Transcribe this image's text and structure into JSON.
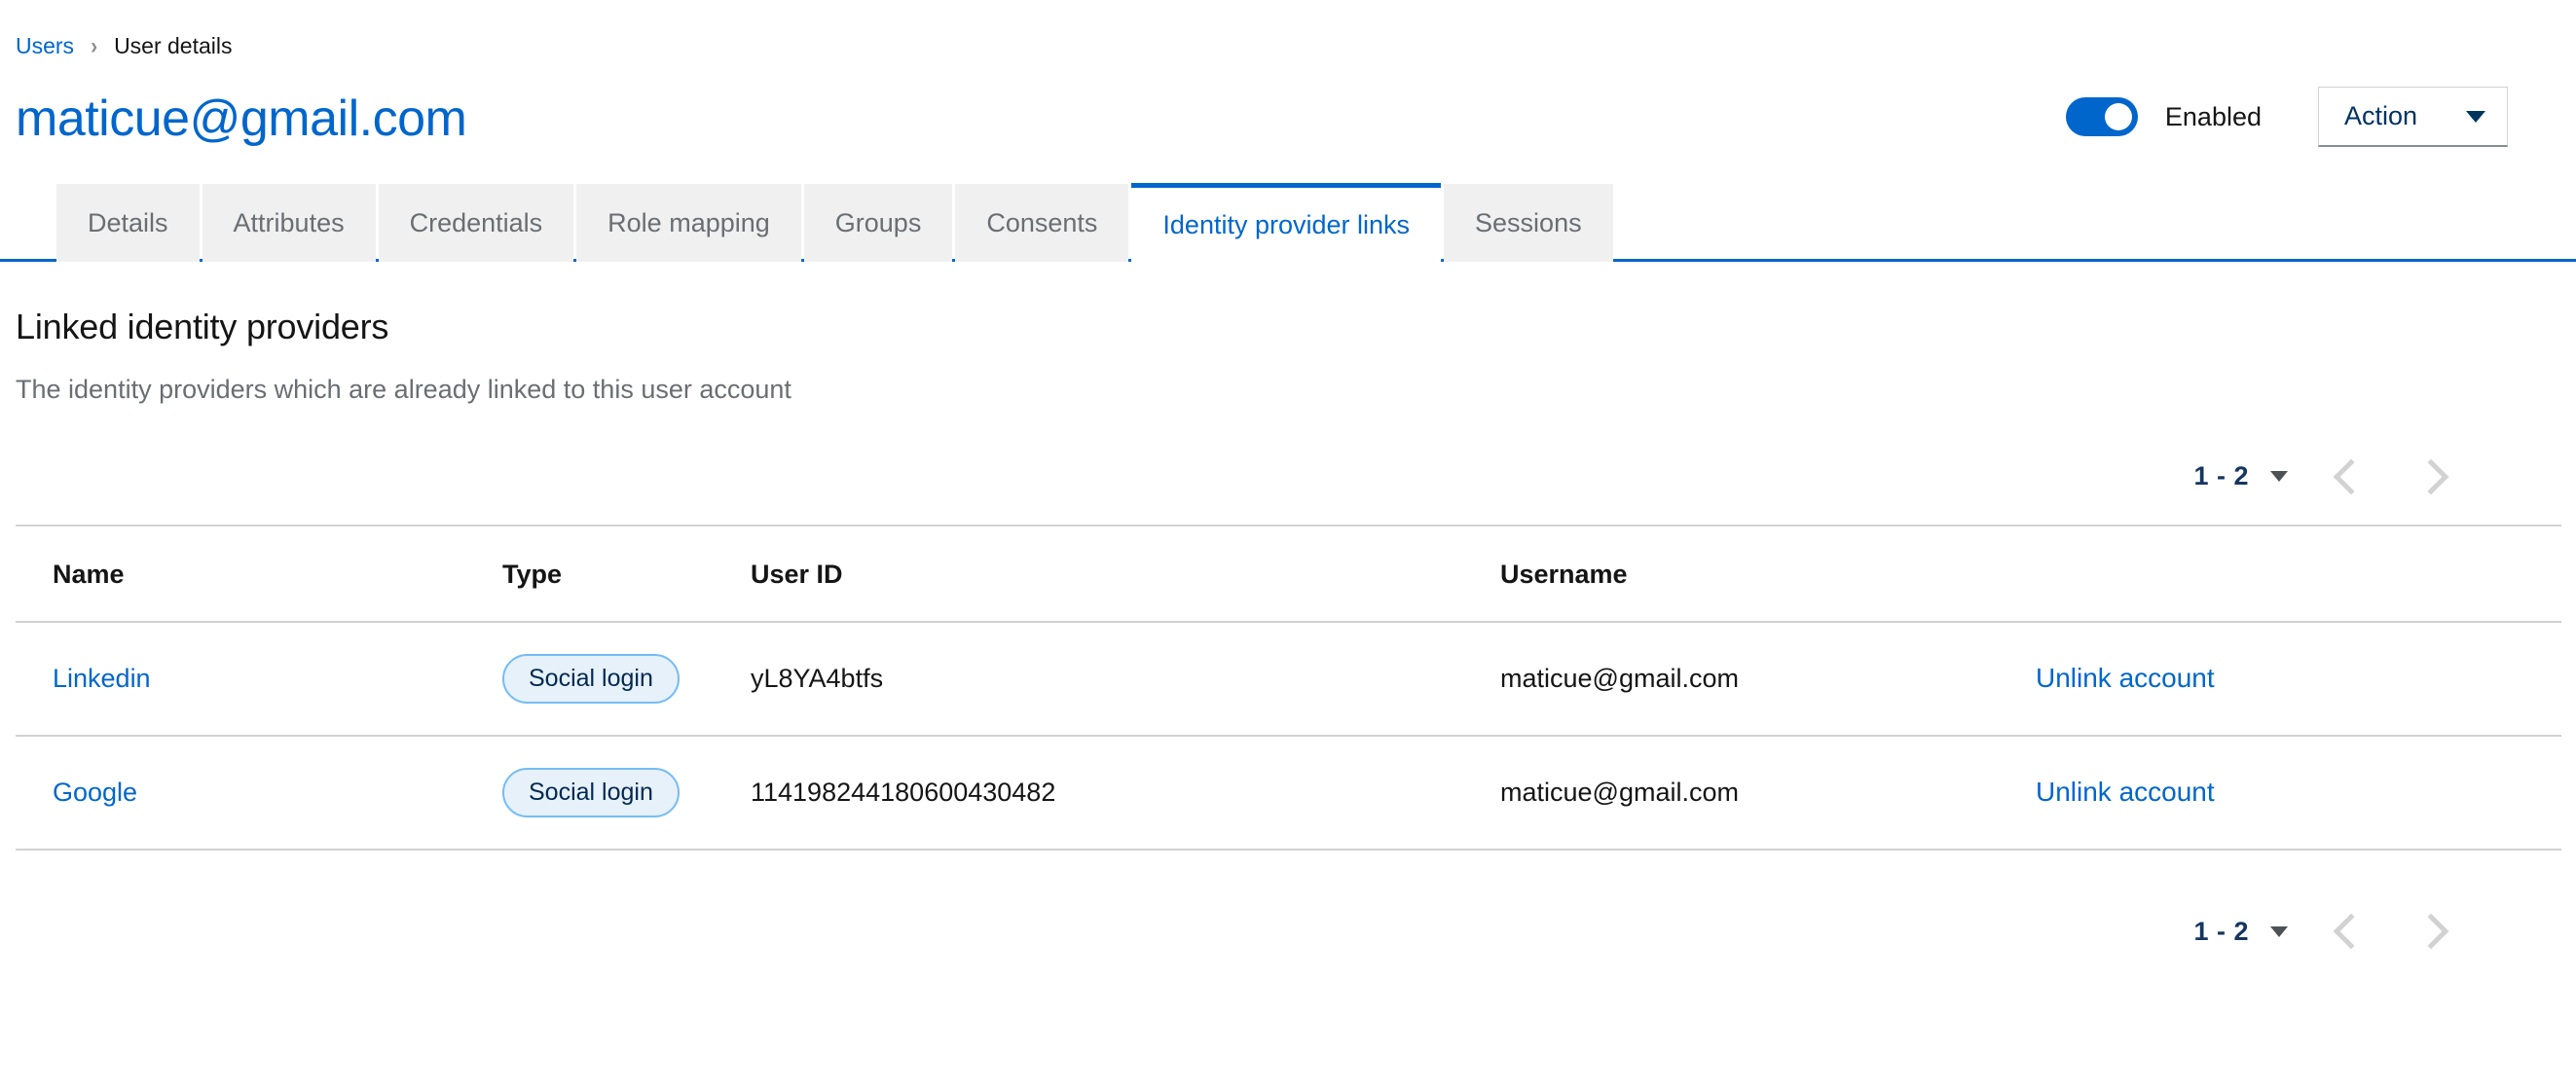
{
  "breadcrumb": {
    "parent": "Users",
    "separator_icon": "chevron-right-icon",
    "current": "User details"
  },
  "header": {
    "title": "maticue@gmail.com",
    "toggle": {
      "state_label": "Enabled",
      "enabled": true,
      "color": "#0066cc"
    },
    "action_button": {
      "label": "Action",
      "caret_icon": "caret-down-icon"
    }
  },
  "tabs": [
    {
      "label": "Details",
      "active": false
    },
    {
      "label": "Attributes",
      "active": false
    },
    {
      "label": "Credentials",
      "active": false
    },
    {
      "label": "Role mapping",
      "active": false
    },
    {
      "label": "Groups",
      "active": false
    },
    {
      "label": "Consents",
      "active": false
    },
    {
      "label": "Identity provider links",
      "active": true
    },
    {
      "label": "Sessions",
      "active": false
    }
  ],
  "section": {
    "title": "Linked identity providers",
    "subtitle": "The identity providers which are already linked to this user account"
  },
  "pagination": {
    "range": "1 - 2",
    "caret_icon": "caret-down-icon",
    "prev_icon": "chevron-left-icon",
    "next_icon": "chevron-right-icon"
  },
  "table": {
    "columns": [
      "Name",
      "Type",
      "User ID",
      "Username",
      ""
    ],
    "rows": [
      {
        "name": "Linkedin",
        "type": "Social login",
        "user_id": "yL8YA4btfs",
        "username": "maticue@gmail.com",
        "action": "Unlink account"
      },
      {
        "name": "Google",
        "type": "Social login",
        "user_id": "114198244180600430482",
        "username": "maticue@gmail.com",
        "action": "Unlink account"
      }
    ]
  },
  "colors": {
    "accent_blue": "#0066cc",
    "link_blue": "#06c",
    "chip_bg": "#e7f1fa",
    "chip_border": "#73bcf7",
    "muted_text": "#6a6e73",
    "tab_inactive_bg": "#f0f0f0"
  }
}
